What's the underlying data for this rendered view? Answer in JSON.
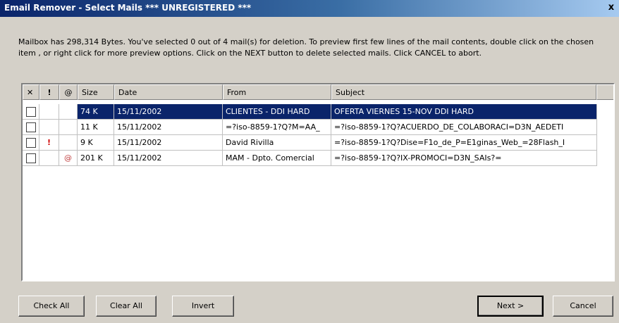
{
  "window": {
    "title": "Email Remover - Select Mails *** UNREGISTERED ***",
    "close_glyph": "x"
  },
  "message": "Mailbox has 298,314 Bytes.  You've selected 0 out of 4 mail(s) for deletion.  To preview first few lines of the mail contents, double click on the chosen item , or right click for more preview options. Click on the NEXT button to delete selected mails.  Click CANCEL to abort.",
  "columns": {
    "delete": "✕",
    "priority": "!",
    "attachment": "@",
    "size": "Size",
    "date": "Date",
    "from": "From",
    "subject": "Subject"
  },
  "mails": [
    {
      "size": "74 K",
      "date": "15/11/2002",
      "from": "CLIENTES - DDI HARD",
      "subject": "OFERTA VIERNES 15-NOV DDI HARD",
      "priority": "",
      "attachment": "",
      "selected": true
    },
    {
      "size": "11 K",
      "date": "15/11/2002",
      "from": "=?iso-8859-1?Q?M=AA_",
      "subject": "=?iso-8859-1?Q?ACUERDO_DE_COLABORACI=D3N_AEDETI",
      "priority": "",
      "attachment": "",
      "selected": false
    },
    {
      "size": "9 K",
      "date": "15/11/2002",
      "from": "David Rivilla",
      "subject": "=?iso-8859-1?Q?Dise=F1o_de_P=E1ginas_Web_=28Flash_I",
      "priority": "!",
      "attachment": "",
      "selected": false
    },
    {
      "size": "201 K",
      "date": "15/11/2002",
      "from": "MAM - Dpto. Comercial",
      "subject": "=?iso-8859-1?Q?IX-PROMOCI=D3N_SAIs?=",
      "priority": "",
      "attachment": "@",
      "selected": false
    }
  ],
  "buttons": {
    "check_all": "Check All",
    "clear_all": "Clear All",
    "invert": "Invert",
    "next": "Next >",
    "cancel": "Cancel"
  }
}
